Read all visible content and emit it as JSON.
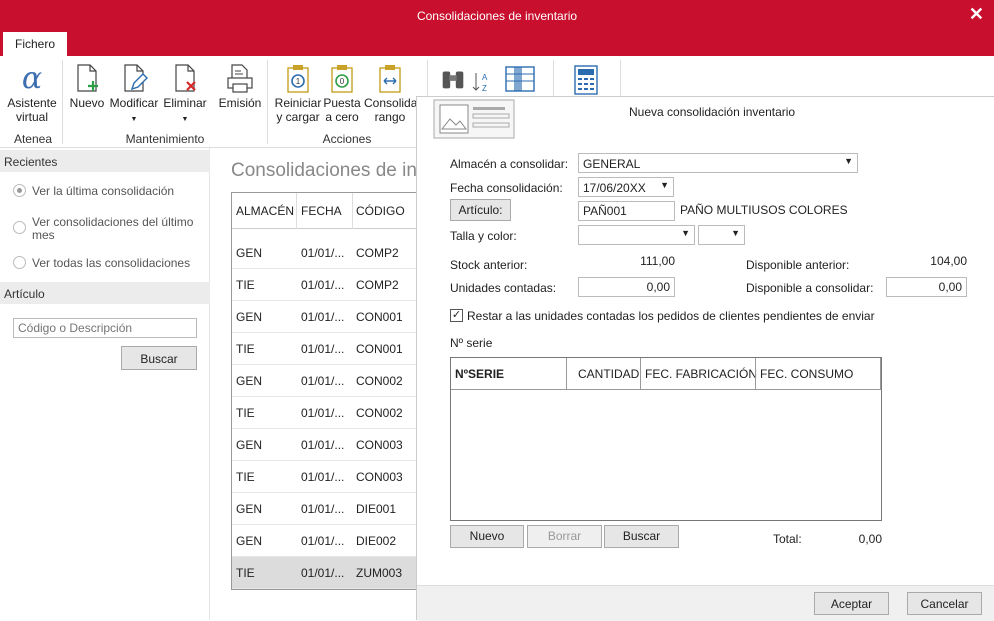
{
  "window": {
    "title": "Consolidaciones de inventario",
    "close_glyph": "✕"
  },
  "tabs": {
    "fichero": "Fichero"
  },
  "ribbon": {
    "asistente": [
      "Asistente",
      "virtual"
    ],
    "nuevo": "Nuevo",
    "modificar": "Modificar",
    "eliminar": "Eliminar",
    "emision": "Emisión",
    "reiniciar": [
      "Reiniciar",
      "y cargar"
    ],
    "puesta": [
      "Puesta",
      "a cero"
    ],
    "consolida": [
      "Consolida",
      "rango"
    ],
    "groups": {
      "atenea": "Atenea",
      "mantenimiento": "Mantenimiento",
      "acciones": "Acciones"
    }
  },
  "sidebar": {
    "recientes": "Recientes",
    "options": [
      {
        "label": "Ver la última consolidación",
        "checked": true
      },
      {
        "label": "Ver consolidaciones del último mes",
        "checked": false
      },
      {
        "label": "Ver todas las consolidaciones",
        "checked": false
      }
    ],
    "articulo": "Artículo",
    "search_placeholder": "Código o Descripción",
    "buscar": "Buscar"
  },
  "main": {
    "title": "Consolidaciones de inventario",
    "columns": [
      "ALMACÉN",
      "FECHA",
      "CÓDIGO"
    ],
    "rows": [
      [
        "GEN",
        "01/01/...",
        "COMP2"
      ],
      [
        "TIE",
        "01/01/...",
        "COMP2"
      ],
      [
        "GEN",
        "01/01/...",
        "CON001"
      ],
      [
        "TIE",
        "01/01/...",
        "CON001"
      ],
      [
        "GEN",
        "01/01/...",
        "CON002"
      ],
      [
        "TIE",
        "01/01/...",
        "CON002"
      ],
      [
        "GEN",
        "01/01/...",
        "CON003"
      ],
      [
        "TIE",
        "01/01/...",
        "CON003"
      ],
      [
        "GEN",
        "01/01/...",
        "DIE001"
      ],
      [
        "GEN",
        "01/01/...",
        "DIE002"
      ],
      [
        "TIE",
        "01/01/...",
        "ZUM003"
      ]
    ]
  },
  "dialog": {
    "title": "Nueva consolidación inventario",
    "almacen_label": "Almacén a consolidar:",
    "almacen_value": "GENERAL",
    "fecha_label": "Fecha consolidación:",
    "fecha_value": "17/06/20XX",
    "articulo_btn": "Artículo:",
    "articulo_code": "PAÑ001",
    "articulo_desc": "PAÑO MULTIUSOS COLORES",
    "talla_label": "Talla y color:",
    "stock_label": "Stock anterior:",
    "stock_value": "111,00",
    "disp_ant_label": "Disponible anterior:",
    "disp_ant_value": "104,00",
    "unidades_label": "Unidades contadas:",
    "unidades_value": "0,00",
    "disp_cons_label": "Disponible a consolidar:",
    "disp_cons_value": "0,00",
    "restar_label": "Restar a las unidades contadas los pedidos de clientes pendientes de enviar",
    "restar_checked": true,
    "nserie_label": "Nº serie",
    "serie_columns": [
      "NºSERIE",
      "CANTIDAD",
      "FEC. FABRICACIÓN",
      "FEC. CONSUMO"
    ],
    "nuevo": "Nuevo",
    "borrar": "Borrar",
    "buscar": "Buscar",
    "total_label": "Total:",
    "total_value": "0,00",
    "aceptar": "Aceptar",
    "cancelar": "Cancelar"
  }
}
